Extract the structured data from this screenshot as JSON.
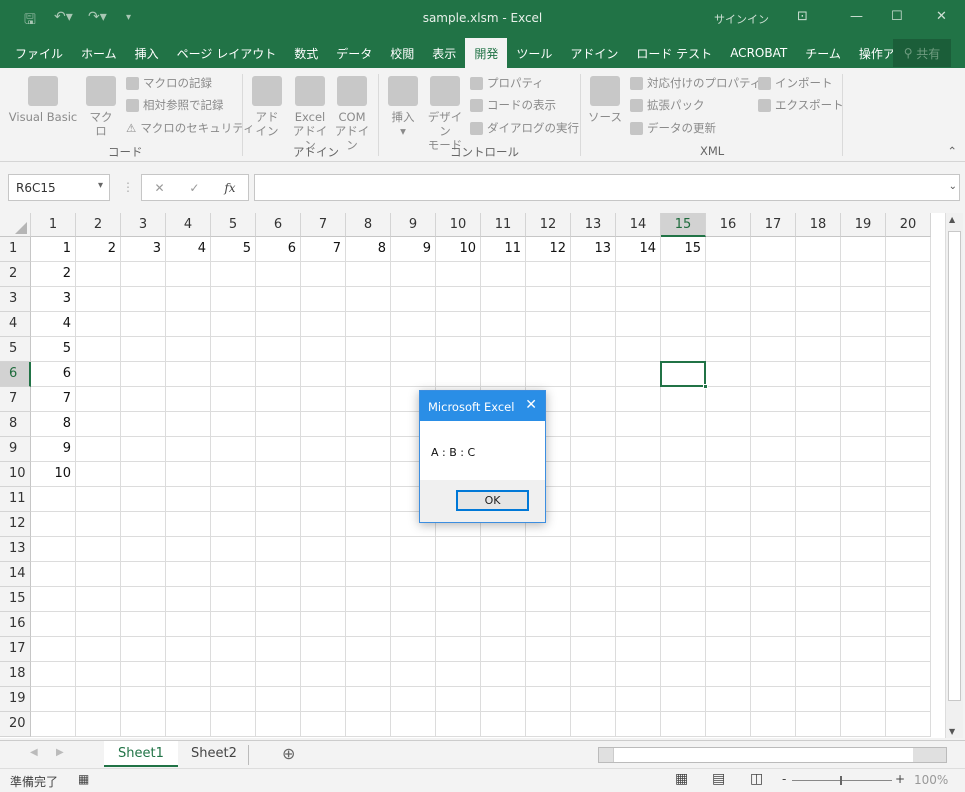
{
  "title": "sample.xlsm  -  Excel",
  "signin": "サインイン",
  "tabs": [
    "ファイル",
    "ホーム",
    "挿入",
    "ページ レイアウト",
    "数式",
    "データ",
    "校閲",
    "表示",
    "開発",
    "ツール",
    "アドイン",
    "ロード テスト",
    "ACROBAT",
    "チーム",
    "操作アシス"
  ],
  "active_tab": "開発",
  "share": "共有",
  "ribbon": {
    "code": {
      "label": "コード",
      "visual_basic": "Visual Basic",
      "macro": "マクロ",
      "record": "マクロの記録",
      "relative": "相対参照で記録",
      "security": "マクロのセキュリティ"
    },
    "addin": {
      "label": "アドイン",
      "addin1": "アド",
      "addin2": "イン",
      "excel1": "Excel",
      "excel2": "アドイン",
      "com1": "COM",
      "com2": "アドイン"
    },
    "control": {
      "label": "コントロール",
      "insert": "挿入",
      "design1": "デザイン",
      "design2": "モード",
      "properties": "プロパティ",
      "view_code": "コードの表示",
      "run_dialog": "ダイアログの実行"
    },
    "xml": {
      "label": "XML",
      "source": "ソース",
      "map_props": "対応付けのプロパティ",
      "expansion": "拡張パック",
      "refresh": "データの更新",
      "import": "インポート",
      "export": "エクスポート"
    }
  },
  "namebox": "R6C15",
  "fx": "fx",
  "formula": "",
  "columns": [
    "1",
    "2",
    "3",
    "4",
    "5",
    "6",
    "7",
    "8",
    "9",
    "10",
    "11",
    "12",
    "13",
    "14",
    "15",
    "16",
    "17",
    "18",
    "19",
    "20"
  ],
  "rows": [
    "1",
    "2",
    "3",
    "4",
    "5",
    "6",
    "7",
    "8",
    "9",
    "10",
    "11",
    "12",
    "13",
    "14",
    "15",
    "16",
    "17",
    "18",
    "19",
    "20"
  ],
  "selected": {
    "row": 6,
    "col": 15
  },
  "cells": {
    "row1": [
      "1",
      "2",
      "3",
      "4",
      "5",
      "6",
      "7",
      "8",
      "9",
      "10",
      "11",
      "12",
      "13",
      "14",
      "15"
    ],
    "col1": [
      "1",
      "2",
      "3",
      "4",
      "5",
      "6",
      "7",
      "8",
      "9",
      "10"
    ]
  },
  "sheets": [
    "Sheet1",
    "Sheet2"
  ],
  "active_sheet": "Sheet1",
  "status": {
    "ready": "準備完了",
    "zoom": "100%"
  },
  "dialog": {
    "title": "Microsoft Excel",
    "message": "A : B : C",
    "ok": "OK"
  },
  "colors": {
    "accent": "#217346",
    "dialog_title": "#2a8ee6"
  }
}
